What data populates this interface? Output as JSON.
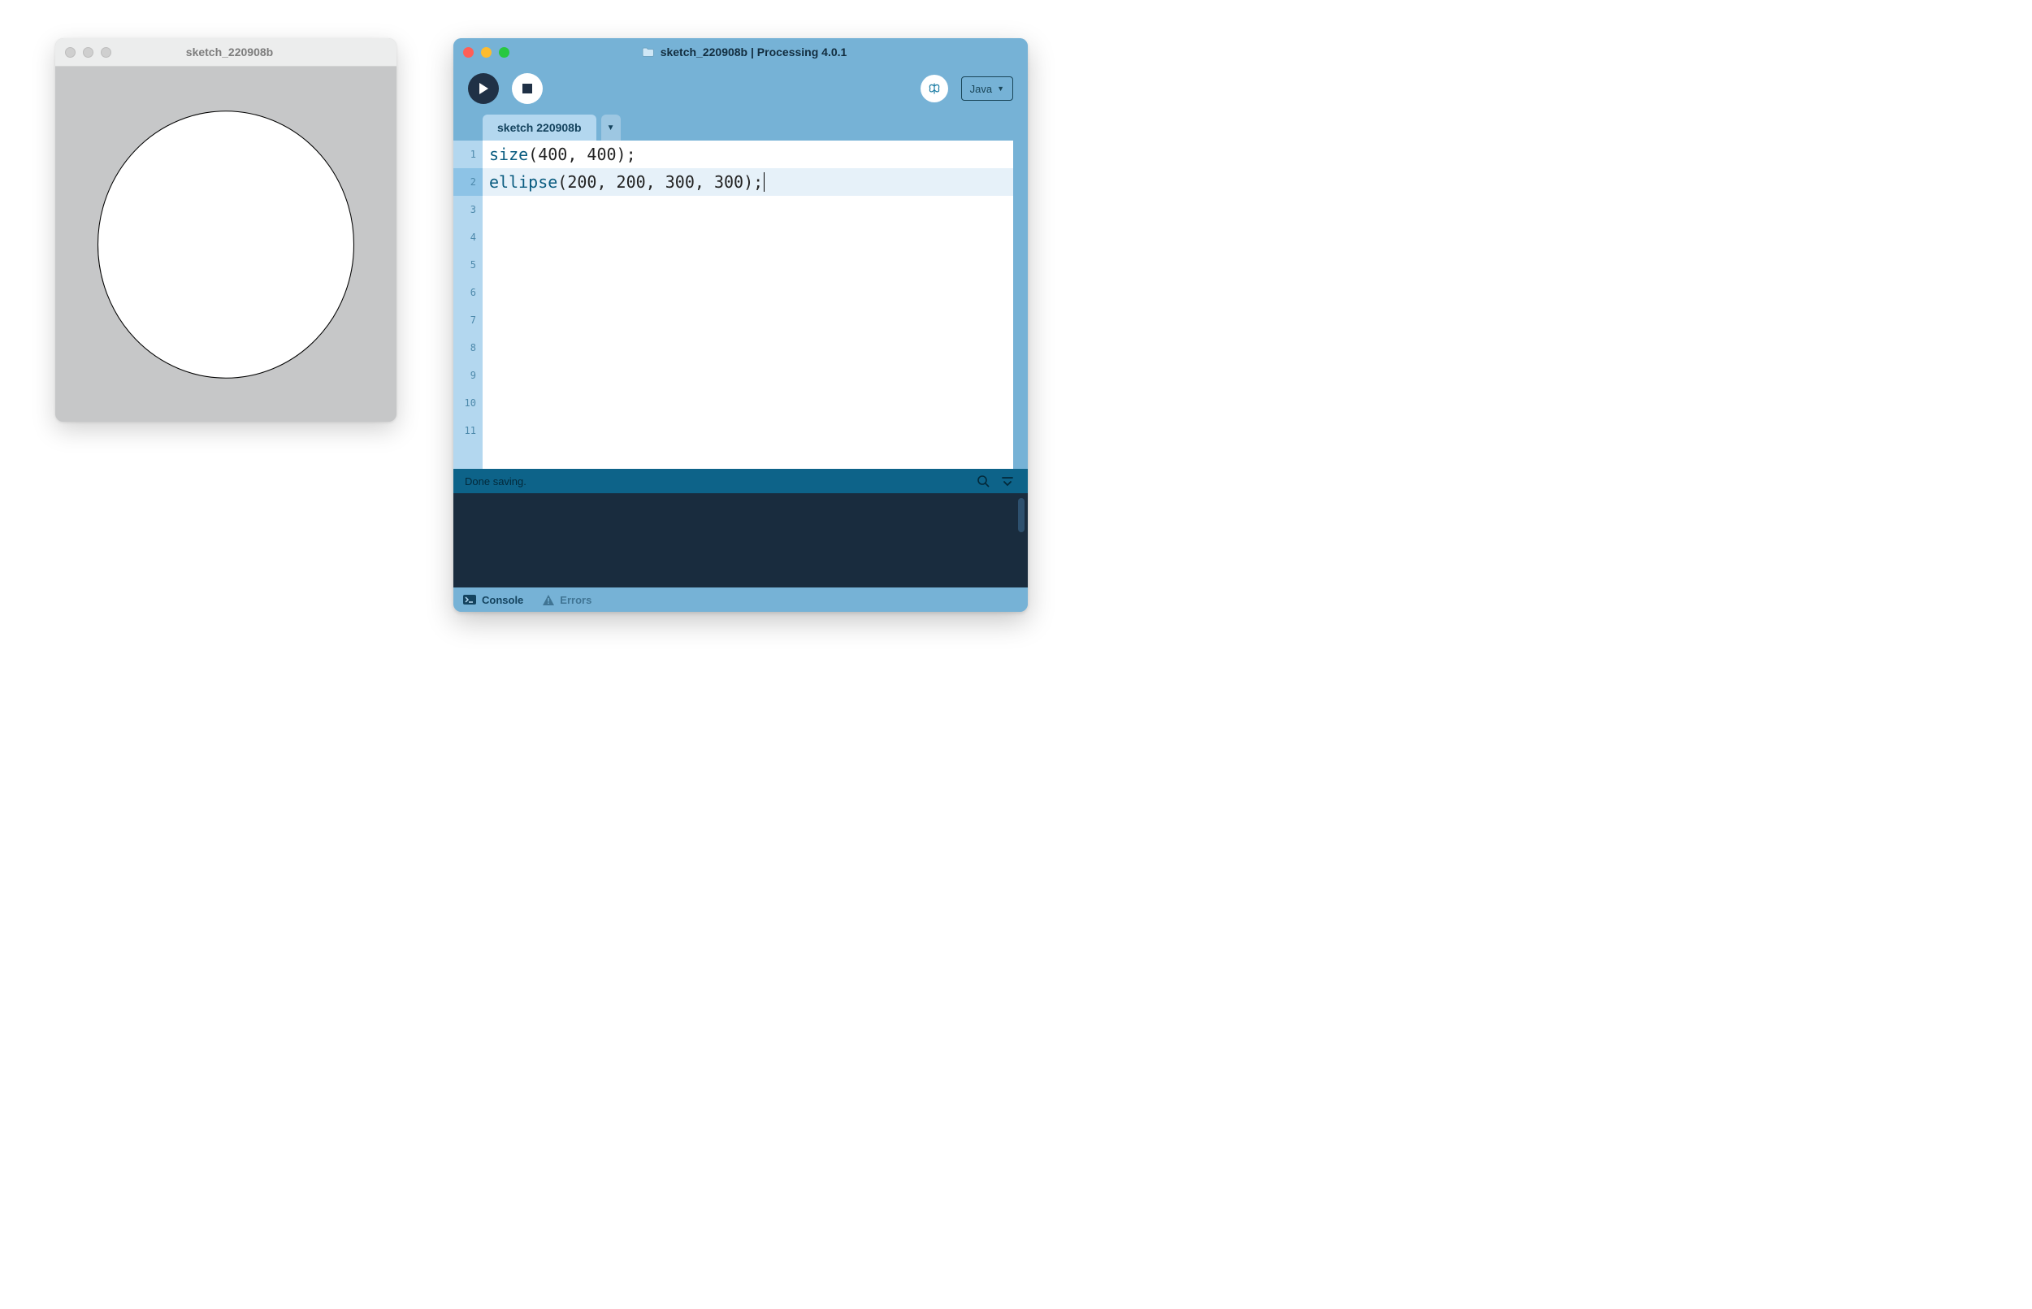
{
  "sketch_window": {
    "title": "sketch_220908b"
  },
  "ide": {
    "title": "sketch_220908b | Processing 4.0.1",
    "mode_label": "Java",
    "tab_label": "sketch 220908b",
    "status_text": "Done saving.",
    "bottom_tabs": {
      "console": "Console",
      "errors": "Errors"
    },
    "code": {
      "line1_fn": "size",
      "line1_rest": "(400, 400);",
      "line2_fn": "ellipse",
      "line2_rest": "(200, 200, 300, 300);"
    },
    "line_numbers": [
      "1",
      "2",
      "3",
      "4",
      "5",
      "6",
      "7",
      "8",
      "9",
      "10",
      "11"
    ],
    "highlighted_line_index": 1
  }
}
